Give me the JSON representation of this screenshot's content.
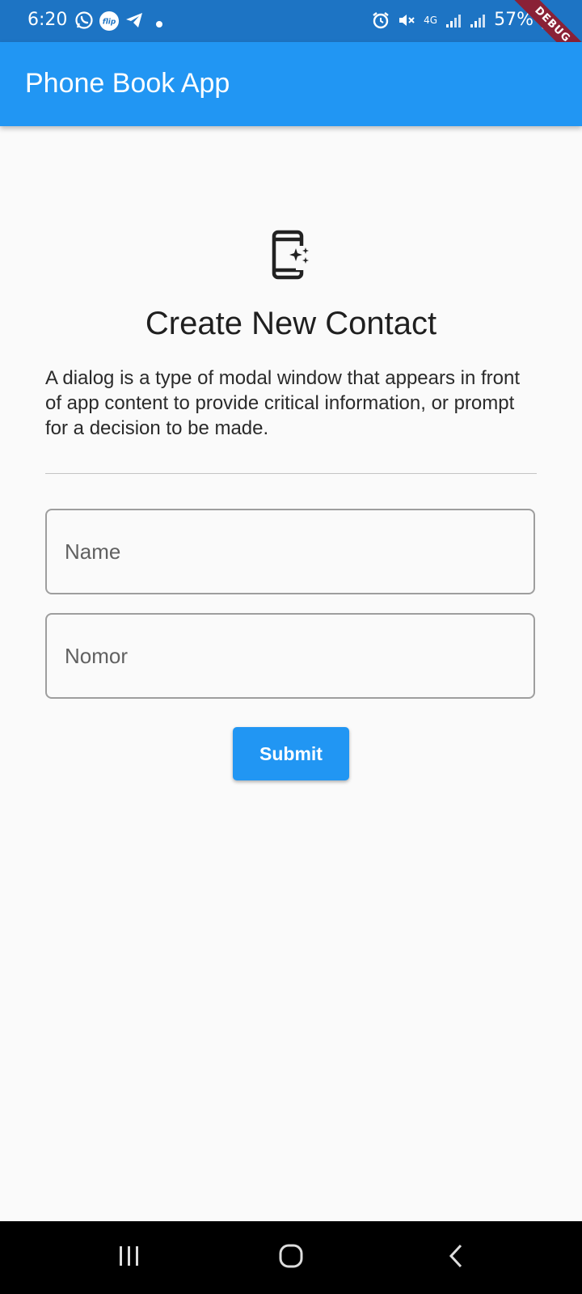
{
  "status_bar": {
    "time": "6:20",
    "battery": "57%",
    "network_label": "4G",
    "icons": [
      "whatsapp-icon",
      "flip-icon",
      "telegram-icon",
      "dot-icon",
      "alarm-icon",
      "mute-icon",
      "signal-icon",
      "battery-icon"
    ],
    "flip_label": "flip",
    "debug_label": "DEBUG"
  },
  "app_bar": {
    "title": "Phone Book App",
    "color": "#2196f3"
  },
  "main": {
    "icon": "phone-sparkle-icon",
    "heading": "Create New Contact",
    "description": "A dialog is a type of modal window that appears in front of app content to provide critical information, or prompt for a decision to be made.",
    "form": {
      "name_placeholder": "Name",
      "name_value": "",
      "nomor_placeholder": "Nomor",
      "nomor_value": "",
      "submit_label": "Submit"
    }
  },
  "nav_bar": {
    "icons": [
      "recent-apps-icon",
      "home-icon",
      "back-icon"
    ]
  },
  "colors": {
    "status_bar": "#1d74c4",
    "primary": "#2196f3",
    "background": "#fafafa",
    "debug_ribbon": "#8a2136"
  }
}
